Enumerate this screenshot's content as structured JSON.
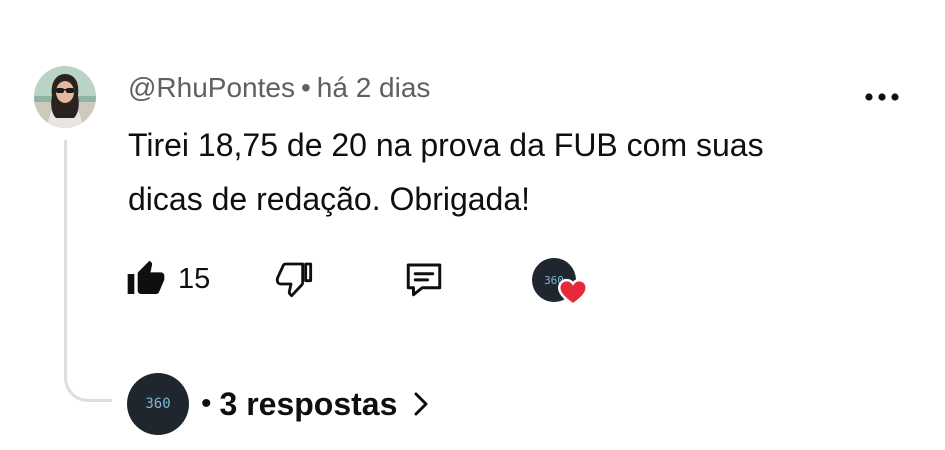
{
  "comment": {
    "author": "@RhuPontes",
    "separator": "•",
    "time": "há 2 dias",
    "text_line1": "Tirei 18,75 de 20 na prova da FUB com suas",
    "text_line2": "dicas de redação. Obrigada!"
  },
  "actions": {
    "like_count": "15",
    "like_icon": "thumbs-up-icon",
    "dislike_icon": "thumbs-down-icon",
    "reply_icon": "comment-reply-icon",
    "creator_heart_icon": "creator-heart-icon"
  },
  "creator": {
    "logo_text": "360"
  },
  "replies": {
    "dot": "•",
    "label": "3 respostas"
  },
  "colors": {
    "text_primary": "#0f0f0f",
    "text_secondary": "#606060",
    "heart": "#e8283b",
    "creator_logo_bg": "#1f262d",
    "creator_logo_fg": "#7fb7d6",
    "thread_line": "#dedede"
  }
}
